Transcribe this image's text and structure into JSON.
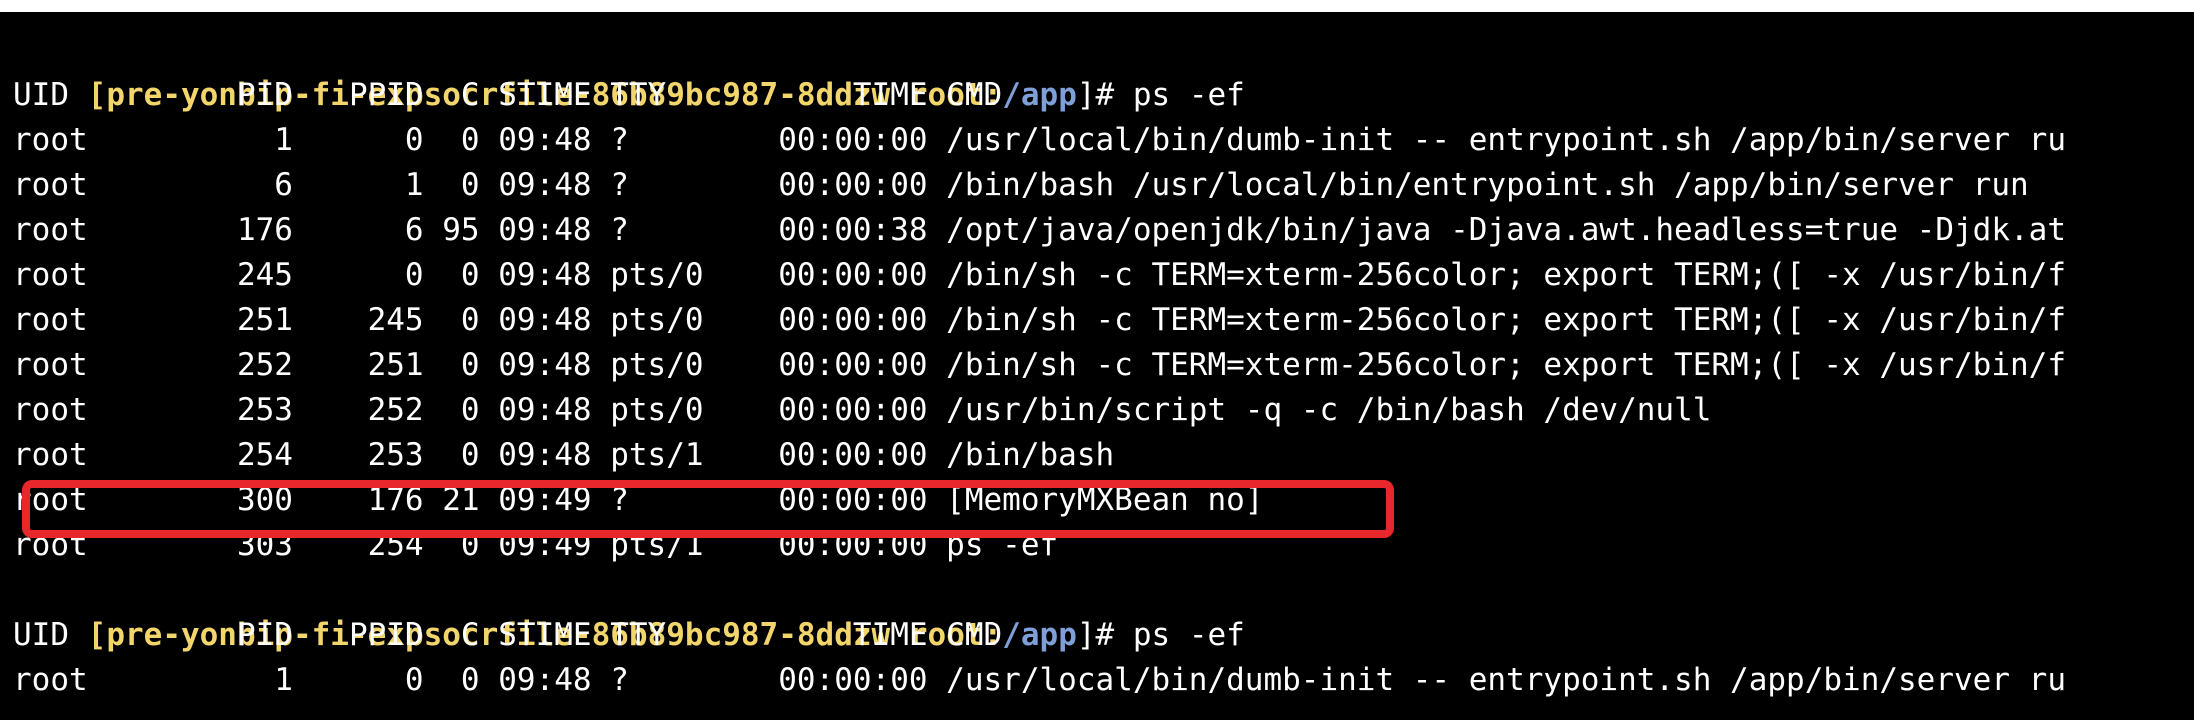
{
  "prompt": {
    "open_bracket": "[",
    "host": "pre-yonbip-fi-expsocrfile-86b89bc987-8ddzw",
    "user": "root",
    "colon": ":",
    "path": "/app",
    "close_bracket": "]# ",
    "command": "ps -ef"
  },
  "header_line": "UID         PID   PPID  C STIME TTY          TIME CMD",
  "block1_rows": [
    "root          1      0  0 09:48 ?        00:00:00 /usr/local/bin/dumb-init -- entrypoint.sh /app/bin/server ru",
    "root          6      1  0 09:48 ?        00:00:00 /bin/bash /usr/local/bin/entrypoint.sh /app/bin/server run",
    "root        176      6 95 09:48 ?        00:00:38 /opt/java/openjdk/bin/java -Djava.awt.headless=true -Djdk.at",
    "root        245      0  0 09:48 pts/0    00:00:00 /bin/sh -c TERM=xterm-256color; export TERM;([ -x /usr/bin/f",
    "root        251    245  0 09:48 pts/0    00:00:00 /bin/sh -c TERM=xterm-256color; export TERM;([ -x /usr/bin/f",
    "root        252    251  0 09:48 pts/0    00:00:00 /bin/sh -c TERM=xterm-256color; export TERM;([ -x /usr/bin/f",
    "root        253    252  0 09:48 pts/0    00:00:00 /usr/bin/script -q -c /bin/bash /dev/null",
    "root        254    253  0 09:48 pts/1    00:00:00 /bin/bash",
    "root        300    176 21 09:49 ?        00:00:00 [MemoryMXBean no]",
    "root        303    254  0 09:49 pts/1    00:00:00 ps -ef"
  ],
  "block2_rows": [
    "root          1      0  0 09:48 ?        00:00:00 /usr/local/bin/dumb-init -- entrypoint.sh /app/bin/server ru"
  ],
  "colors": {
    "background": "#000000",
    "text": "#ffffff",
    "prompt_host": "#f2d56b",
    "prompt_path": "#7f9fd8",
    "highlight_border": "#e8272d"
  }
}
